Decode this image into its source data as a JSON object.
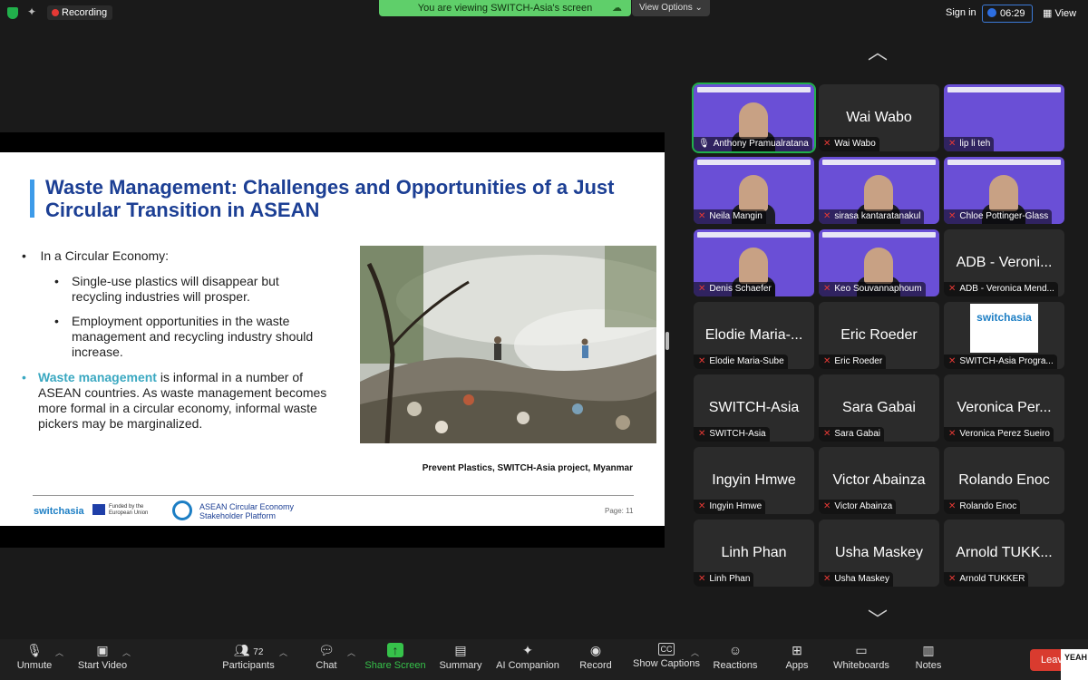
{
  "topbar": {
    "recording": "Recording",
    "viewing_banner": "You are viewing SWITCH-Asia's screen",
    "view_options": "View Options",
    "sign_in": "Sign in",
    "timer": "06:29",
    "view": "View"
  },
  "slide": {
    "title": "Waste Management: Challenges and Opportunities of a Just Circular Transition in ASEAN",
    "bullet1": "In a Circular Economy:",
    "sub1": "Single-use plastics will disappear but recycling industries will prosper.",
    "sub2": "Employment opportunities in the waste management and recycling industry should increase.",
    "bullet2_highlight": "Waste management",
    "bullet2_rest": " is informal in a number of ASEAN countries. As waste management becomes more formal in a circular economy, informal waste pickers may be marginalized.",
    "caption": "Prevent Plastics, SWITCH-Asia project, Myanmar",
    "footer_brand": "switchasia",
    "footer_funded": "Funded by the European Union",
    "footer_platform_line1": "ASEAN Circular Economy",
    "footer_platform_line2": "Stakeholder Platform",
    "page": "Page: 11",
    "colors": {
      "title": "#1c3f94",
      "highlight": "#3aa8c1",
      "accent": "#3d9be9"
    }
  },
  "participants": [
    {
      "big": "",
      "label": "Anthony Pramualratana",
      "video": true,
      "active": true
    },
    {
      "big": "Wai Wabo",
      "label": "Wai Wabo",
      "video": false
    },
    {
      "big": "",
      "label": "lip li teh",
      "video": true
    },
    {
      "big": "",
      "label": "Neila Mangin",
      "video": true
    },
    {
      "big": "",
      "label": "sirasa kantaratanakul",
      "video": true
    },
    {
      "big": "",
      "label": "Chloe Pottinger-Glass",
      "video": true
    },
    {
      "big": "",
      "label": "Denis Schaefer",
      "video": true
    },
    {
      "big": "",
      "label": "Keo Souvannaphoum",
      "video": true
    },
    {
      "big": "ADB - Veroni...",
      "label": "ADB - Veronica Mend...",
      "video": false
    },
    {
      "big": "Elodie Maria-...",
      "label": "Elodie Maria-Sube",
      "video": false
    },
    {
      "big": "Eric Roeder",
      "label": "Eric Roeder",
      "video": false
    },
    {
      "big": "",
      "label": "SWITCH-Asia Progra...",
      "video": false,
      "logo": "switchasia"
    },
    {
      "big": "SWITCH-Asia",
      "label": "SWITCH-Asia",
      "video": false
    },
    {
      "big": "Sara Gabai",
      "label": "Sara Gabai",
      "video": false
    },
    {
      "big": "Veronica Per...",
      "label": "Veronica Perez Sueiro",
      "video": false
    },
    {
      "big": "Ingyin Hmwe",
      "label": "Ingyin Hmwe",
      "video": false
    },
    {
      "big": "Victor Abainza",
      "label": "Victor Abainza",
      "video": false
    },
    {
      "big": "Rolando Enoc",
      "label": "Rolando Enoc",
      "video": false
    },
    {
      "big": "Linh Phan",
      "label": "Linh Phan",
      "video": false
    },
    {
      "big": "Usha Maskey",
      "label": "Usha Maskey",
      "video": false
    },
    {
      "big": "Arnold TUKK...",
      "label": "Arnold TUKKER",
      "video": false
    }
  ],
  "toolbar": {
    "unmute": "Unmute",
    "start_video": "Start Video",
    "participants": "Participants",
    "participant_count": "72",
    "chat": "Chat",
    "share_screen": "Share Screen",
    "summary": "Summary",
    "ai_companion": "AI Companion",
    "record": "Record",
    "show_captions": "Show Captions",
    "reactions": "Reactions",
    "apps": "Apps",
    "whiteboards": "Whiteboards",
    "notes": "Notes",
    "leave": "Leave",
    "yeah": "YEAH"
  }
}
